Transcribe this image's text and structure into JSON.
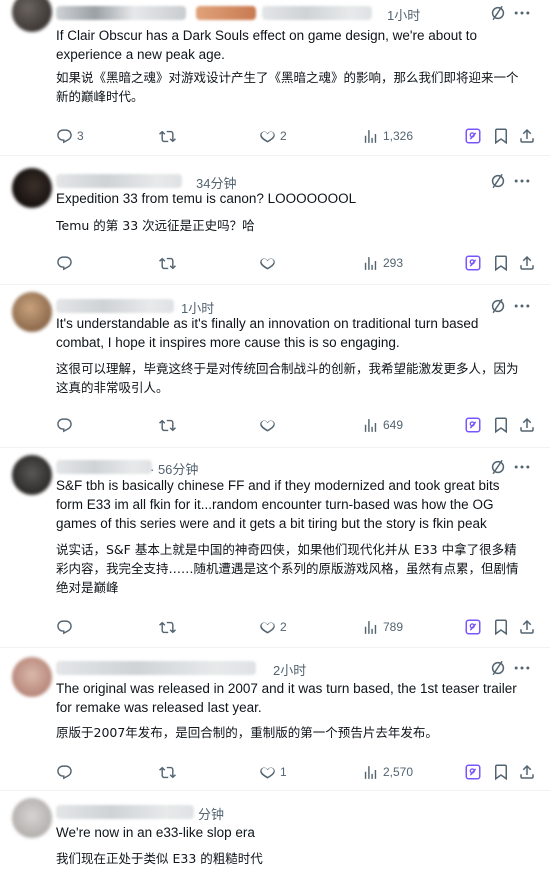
{
  "colors": {
    "icon": "#536471",
    "grok_accent": "#7856ff",
    "text": "#0f1419",
    "muted": "#536471"
  },
  "replies": [
    {
      "time": "1小时",
      "text_en": "If Clair Obscur has a Dark Souls effect on game design, we're about to experience a new peak age.",
      "text_zh": "如果说《黑暗之魂》对游戏设计产生了《黑暗之魂》的影响，那么我们即将迎来一个新的巅峰时代。",
      "reply_count": "3",
      "retweet_count": "",
      "like_count": "2",
      "view_count": "1,326"
    },
    {
      "time": "34分钟",
      "text_en": "Expedition 33 from temu is canon? LOOOOOOOL",
      "text_zh": "Temu 的第 33 次远征是正史吗？哈",
      "reply_count": "",
      "retweet_count": "",
      "like_count": "",
      "view_count": "293"
    },
    {
      "time": "1小时",
      "text_en": "It's understandable as it's finally an innovation on traditional turn based combat, I hope it inspires more cause this is so engaging.",
      "text_zh": "这很可以理解，毕竟这终于是对传统回合制战斗的创新，我希望能激发更多人，因为这真的非常吸引人。",
      "reply_count": "",
      "retweet_count": "",
      "like_count": "",
      "view_count": "649"
    },
    {
      "time": "· 56分钟",
      "text_en": "S&F tbh is basically chinese FF and if they modernized and took great bits form E33 im all fkin for it...random encounter turn-based was how the OG games of this series were and it gets a bit tiring but the story is fkin peak",
      "text_zh": "说实话，S&F 基本上就是中国的神奇四侠，如果他们现代化并从 E33 中拿了很多精彩内容，我完全支持……随机遭遇是这个系列的原版游戏风格，虽然有点累，但剧情绝对是巅峰",
      "reply_count": "",
      "retweet_count": "",
      "like_count": "2",
      "view_count": "789"
    },
    {
      "time": "2小时",
      "text_en": "The original was released in 2007 and it was turn based, the 1st teaser trailer for remake was released last year.",
      "text_zh": "原版于2007年发布，是回合制的，重制版的第一个预告片去年发布。",
      "reply_count": "",
      "retweet_count": "",
      "like_count": "1",
      "view_count": "2,570"
    },
    {
      "time": "分钟",
      "text_en": "We're now in an e33-like slop era",
      "text_zh": "我们现在正处于类似 E33 的粗糙时代",
      "reply_count": "",
      "retweet_count": "",
      "like_count": "",
      "view_count": ""
    }
  ]
}
